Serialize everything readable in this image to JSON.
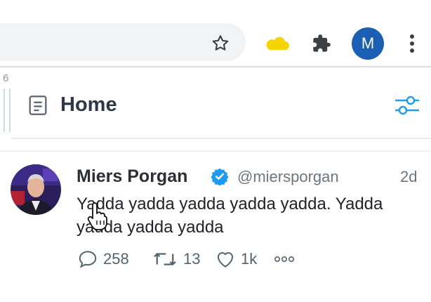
{
  "browser": {
    "avatar_letter": "M",
    "accent_color": "#1a5fb4"
  },
  "column": {
    "rail_number": "6",
    "title": "Home",
    "icon": "document-icon",
    "filter_icon": "filter-sliders-icon"
  },
  "tweet": {
    "author_name": "Miers Porgan",
    "handle": "@miersporgan",
    "time": "2d",
    "verified": true,
    "text": "Yadda yadda yadda yadda yadda. Yadda yadda yadda yadda",
    "replies": "258",
    "retweets": "13",
    "likes": "1k"
  }
}
